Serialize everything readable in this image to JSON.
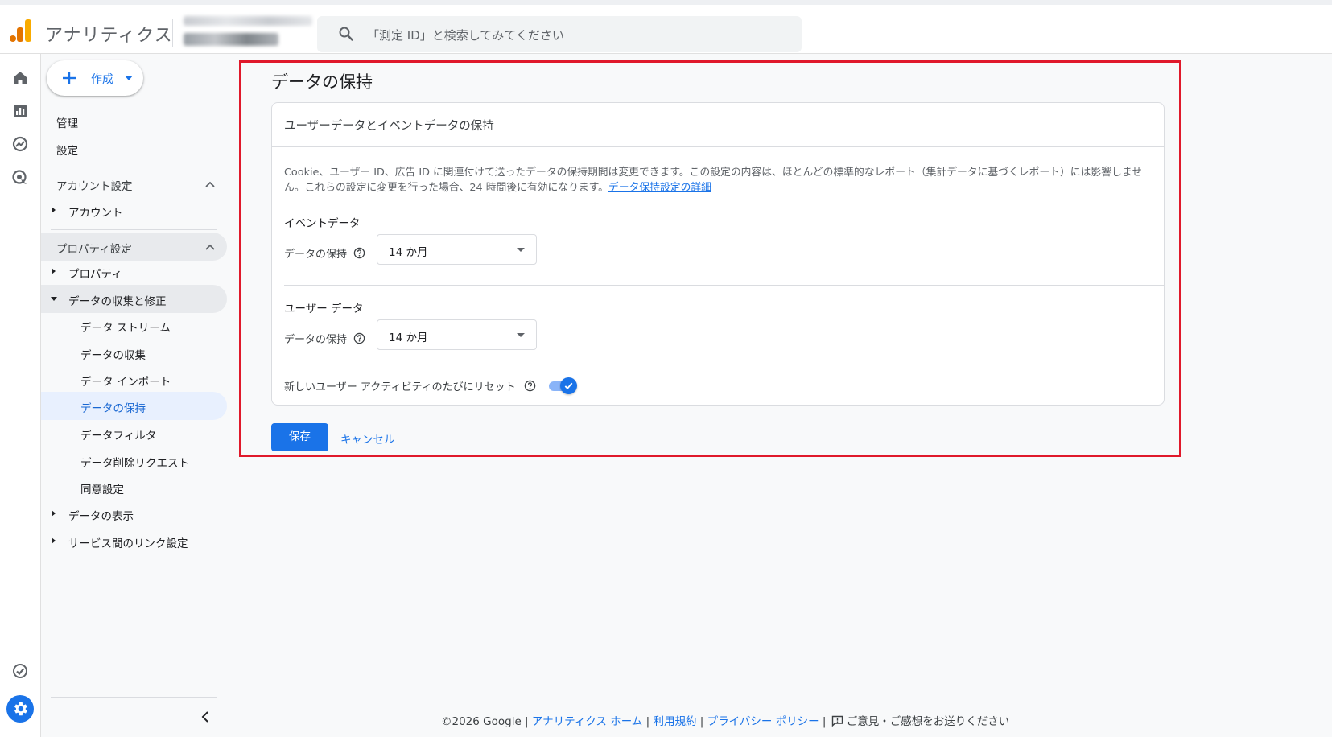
{
  "header": {
    "app_title": "アナリティクス",
    "search_placeholder": "「測定 ID」と検索してみてください"
  },
  "nav": {
    "create_label": "作成",
    "admin": "管理",
    "settings": "設定",
    "account_settings": "アカウント設定",
    "account": "アカウント",
    "property_settings": "プロパティ設定",
    "property": "プロパティ",
    "data_collection": "データの収集と修正",
    "sub_items": [
      "データ ストリーム",
      "データの収集",
      "データ インポート",
      "データの保持",
      "データフィルタ",
      "データ削除リクエスト",
      "同意設定"
    ],
    "data_display": "データの表示",
    "service_links": "サービス間のリンク設定"
  },
  "main": {
    "page_title": "データの保持",
    "card_title": "ユーザーデータとイベントデータの保持",
    "description": "Cookie、ユーザー ID、広告 ID に関連付けて送ったデータの保持期間は変更できます。この設定の内容は、ほとんどの標準的なレポート（集計データに基づくレポート）には影響しません。これらの設定に変更を行った場合、24 時間後に有効になります。",
    "description_link": "データ保持設定の詳細",
    "event_section": "イベントデータ",
    "event_label": "データの保持",
    "event_value": "14 か月",
    "user_section": "ユーザー データ",
    "user_label": "データの保持",
    "user_value": "14 か月",
    "reset_label": "新しいユーザー アクティビティのたびにリセット",
    "reset_enabled": true,
    "save_label": "保存",
    "cancel_label": "キャンセル"
  },
  "footer": {
    "copyright": "©2026 Google",
    "links": [
      "アナリティクス ホーム",
      "利用規約",
      "プライバシー ポリシー"
    ],
    "feedback": "ご意見・ご感想をお送りください"
  },
  "colors": {
    "accent": "#1a73e8",
    "highlight_frame": "#e0192b",
    "logo_orange": "#f9ab00",
    "logo_dark_orange": "#e37400"
  }
}
